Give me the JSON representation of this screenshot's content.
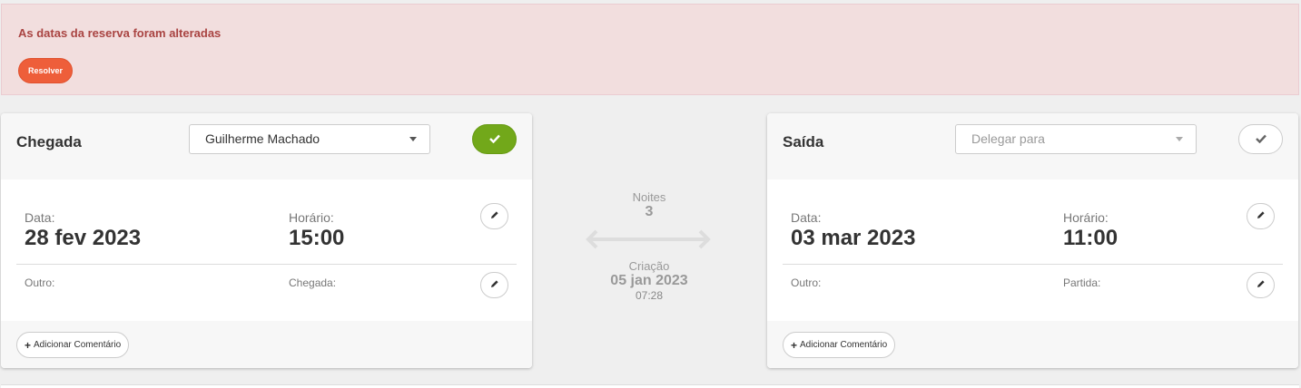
{
  "alert": {
    "message": "As datas da reserva foram alteradas",
    "resolve_label": "Resolver"
  },
  "arrival": {
    "title": "Chegada",
    "assignee": "Guilherme Machado",
    "date_label": "Data:",
    "date_value": "28 fev 2023",
    "time_label": "Horário:",
    "time_value": "15:00",
    "other_label": "Outro:",
    "extra_label": "Chegada:",
    "comment_label": "Adicionar Comentário"
  },
  "departure": {
    "title": "Saída",
    "assignee_placeholder": "Delegar para",
    "date_label": "Data:",
    "date_value": "03 mar 2023",
    "time_label": "Horário:",
    "time_value": "11:00",
    "other_label": "Outro:",
    "extra_label": "Partida:",
    "comment_label": "Adicionar Comentário"
  },
  "summary": {
    "nights_label": "Noites",
    "nights_value": "3",
    "created_label": "Criação",
    "created_date": "05 jan 2023",
    "created_time": "07:28"
  },
  "colors": {
    "alert_bg": "#f2dede",
    "alert_text": "#a94442",
    "resolve_btn": "#ee5e3a",
    "confirmed_green": "#72a81a"
  },
  "icons": {
    "check": "check-icon",
    "edit": "pencil-icon",
    "plus": "plus-icon",
    "arrows": "double-arrow-icon"
  }
}
